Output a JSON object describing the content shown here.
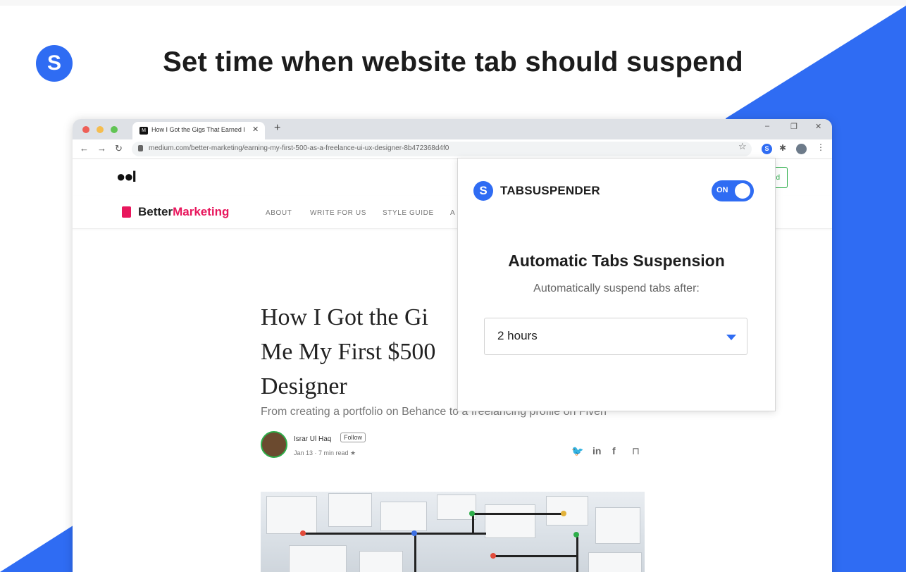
{
  "promo": {
    "logo_letter": "S",
    "headline": "Set time when website tab should suspend",
    "accent_color": "#2f6cf3"
  },
  "browser": {
    "tab_title": "How I Got the Gigs That Earned I",
    "tab_icon_letter": "M",
    "url": "medium.com/better-marketing/earning-my-first-500-as-a-freelance-ui-ux-designer-8b472368d4f0",
    "icons": [
      "back-icon",
      "forward-icon",
      "reload-icon",
      "lock-icon",
      "star-icon",
      "extension-icon",
      "puzzle-icon",
      "profile-icon",
      "menu-icon"
    ]
  },
  "medium": {
    "logo": "●●I",
    "publication": {
      "name_part1": "Better",
      "name_part2": "Marketing",
      "accent": "#e8175d"
    },
    "nav": [
      "ABOUT",
      "WRITE FOR US",
      "STYLE GUIDE",
      "A"
    ],
    "follow_edge": "d",
    "article": {
      "title_line1": "How I Got the Gi",
      "title_line2": "Me My First $500",
      "title_line3": "Designer",
      "subtitle": "From creating a portfolio on Behance to a freelancing profile on Fiverr",
      "author": "Israr Ul Haq",
      "follow_label": "Follow",
      "meta": "Jan 13 · 7 min read ★"
    }
  },
  "popup": {
    "logo_letter": "S",
    "brand": "TABSUSPENDER",
    "toggle_label": "ON",
    "toggle_on": true,
    "title": "Automatic Tabs Suspension",
    "subtitle": "Automatically suspend tabs after:",
    "selected_value": "2 hours"
  }
}
